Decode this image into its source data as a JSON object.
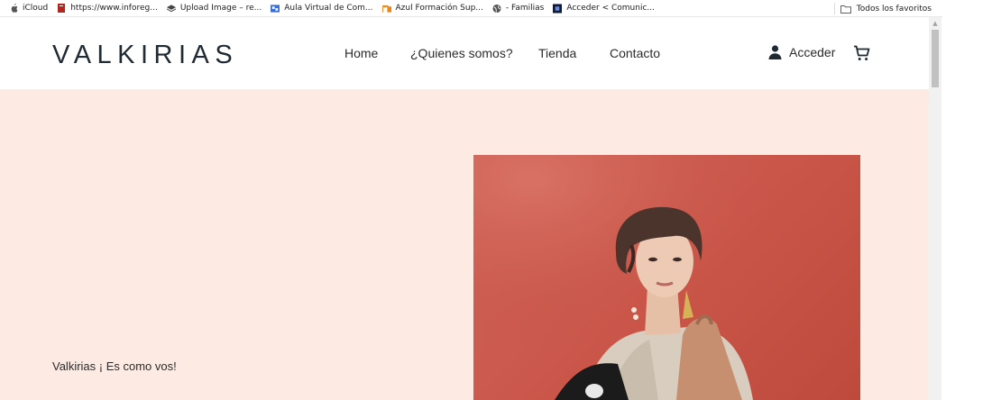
{
  "bookmarks": {
    "items": [
      {
        "label": "iCloud",
        "icon": "apple-icon"
      },
      {
        "label": "https://www.inforeg...",
        "icon": "bookmark-red-icon"
      },
      {
        "label": "Upload Image – re...",
        "icon": "layers-icon"
      },
      {
        "label": "Aula Virtual de Com...",
        "icon": "moodle-icon"
      },
      {
        "label": "Azul Formación Sup...",
        "icon": "moodle-orange-icon"
      },
      {
        "label": "- Familias",
        "icon": "globe-icon"
      },
      {
        "label": "Acceder < Comunic...",
        "icon": "site-icon"
      }
    ],
    "all_bookmarks": "Todos los favoritos"
  },
  "header": {
    "logo": "VALKIRIAS",
    "nav": [
      "Home",
      "¿Quienes somos?",
      "Tienda",
      "Contacto"
    ],
    "login_label": "Acceder"
  },
  "hero": {
    "tagline": "Valkirias ¡ Es como vos!",
    "background_color": "#fdebe3",
    "photo_background": "#c95548"
  }
}
